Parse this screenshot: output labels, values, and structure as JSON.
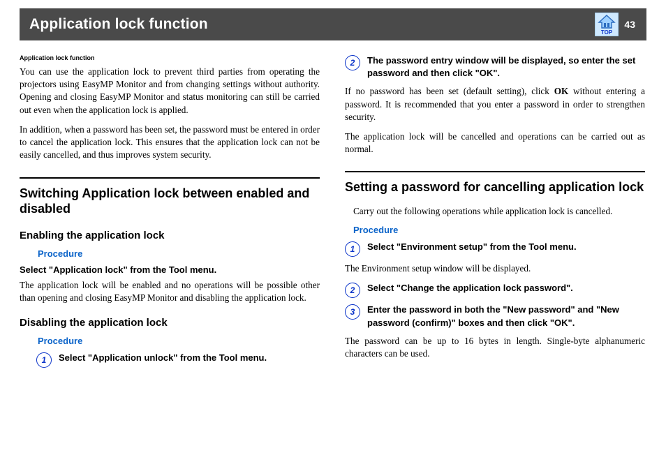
{
  "header": {
    "title": "Application lock function",
    "page_number": "43",
    "top_icon_label": "TOP"
  },
  "left": {
    "breadcrumb": "Application lock function",
    "intro1": "You can use the application lock to prevent third parties from operating the projectors using EasyMP Monitor and from changing settings without authority. Opening and closing EasyMP Monitor and status monitoring can still be carried out even when the application lock is applied.",
    "intro2": "In addition, when a password has been set, the password must be entered in order to cancel the application lock. This ensures that the application lock can not be easily cancelled, and thus improves system security.",
    "section": "Switching Application lock between enabled and disabled",
    "enable": {
      "heading": "Enabling the application lock",
      "procedure_label": "Procedure",
      "step_heading": "Select \"Application lock\" from the Tool menu.",
      "text": "The application lock will be enabled and no operations will be possible other than opening and closing EasyMP Monitor and disabling the application lock."
    },
    "disable": {
      "heading": "Disabling the application lock",
      "procedure_label": "Procedure",
      "steps": [
        {
          "n": "1",
          "t": "Select \"Application unlock\" from the Tool menu."
        }
      ]
    }
  },
  "right": {
    "steps_cont": [
      {
        "n": "2",
        "t": "The password entry window will be displayed, so enter the set password and then click \"OK\"."
      }
    ],
    "note1_prefix": "If no password has been set (default setting), click ",
    "note1_bold": "OK",
    "note1_suffix": " without entering a password. It is recommended that you enter a password in order to strengthen security.",
    "note2": "The application lock will be cancelled and operations can be carried out as normal.",
    "section": "Setting a password for cancelling application lock",
    "intro": "Carry out the following operations while application lock is cancelled.",
    "procedure_label": "Procedure",
    "steps": [
      {
        "n": "1",
        "t": "Select \"Environment setup\" from the Tool menu."
      },
      {
        "n": "2",
        "t": "Select \"Change the application lock password\"."
      },
      {
        "n": "3",
        "t": "Enter the password in both the \"New password\" and \"New password (confirm)\" boxes and then click \"OK\"."
      }
    ],
    "step1_note": "The Environment setup window will be displayed.",
    "step3_note": "The password can be up to 16 bytes in length. Single-byte alphanumeric characters can be used."
  }
}
